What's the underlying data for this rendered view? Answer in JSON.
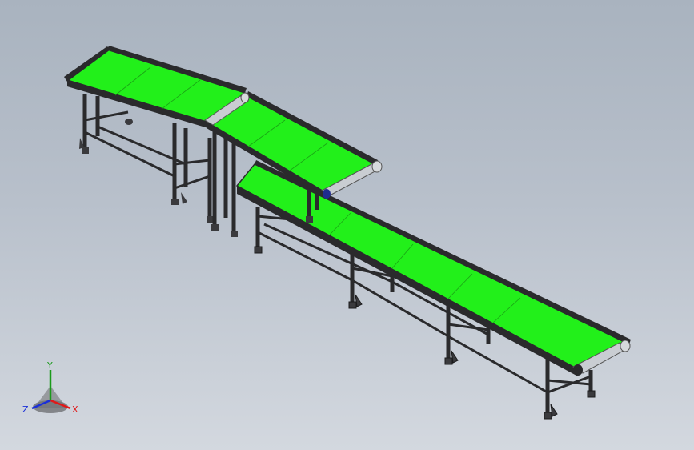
{
  "viewport": {
    "background_top": "#a9b3bf",
    "background_bottom": "#d3d8df"
  },
  "model": {
    "description_icon": "belt-conveyor-assembly",
    "belt_color": "#22f01a",
    "frame_color": "#2a2a2c",
    "roller_color": "#c9cdd2"
  },
  "triad": {
    "x_label": "X",
    "y_label": "Y",
    "z_label": "Z",
    "x_color": "#e01818",
    "y_color": "#1a9a1a",
    "z_color": "#1a2fd8"
  }
}
